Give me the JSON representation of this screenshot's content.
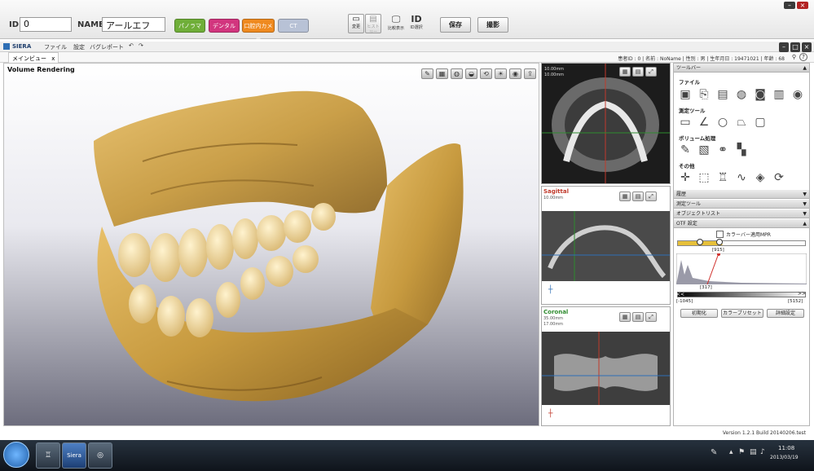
{
  "topbar": {
    "id_label": "ID",
    "id_value": "0",
    "name_label": "NAME",
    "name_value": "アールエフ",
    "mode_buttons": [
      {
        "label": "パノラマ",
        "color": "#6fae38"
      },
      {
        "label": "デンタル",
        "color": "#d2357e"
      },
      {
        "label": "口腔内カメラ",
        "color": "#ef8a1f"
      },
      {
        "label": "CT",
        "color": "#b8c2d6"
      }
    ],
    "icon_buttons": [
      {
        "label": "変更",
        "icon": "folder-icon"
      },
      {
        "label": "ヒストリー",
        "icon": "history-icon"
      },
      {
        "label": "比較表示",
        "icon": "monitor-icon"
      },
      {
        "label": "ID選択",
        "icon": "id-icon"
      }
    ],
    "id_icon_text": "ID",
    "save_label": "保存",
    "capture_label": "撮影"
  },
  "app": {
    "logo": "SIERA",
    "menu": [
      "ファイル",
      "設定",
      "バグレポート"
    ],
    "tab_label": "メインビュー",
    "tab_close": "x",
    "patient_info": "患者ID : 0 | 名前 : NoName | 性別 : 男 | 生年月日 : 19471021 | 年齢 : 68"
  },
  "mainview": {
    "title": "Volume Rendering"
  },
  "slices": {
    "axial": {
      "sub1": "10.00mm",
      "sub2": "10.00mm"
    },
    "sagittal": {
      "label": "Sagittal",
      "sub1": "10.00mm",
      "color": "#c0392b"
    },
    "coronal": {
      "label": "Coronal",
      "sub1": "35.00mm",
      "sub2": "17.00mm",
      "color": "#2e8b2e"
    }
  },
  "toolbar": {
    "title": "ツールバー",
    "groups": [
      {
        "title": "ファイル",
        "icons": [
          "open-icon",
          "export-icon",
          "save-icon",
          "print-icon",
          "camera-icon",
          "scan-icon",
          "cd-icon"
        ]
      },
      {
        "title": "測定ツール",
        "icons": [
          "ruler-icon",
          "angle-icon",
          "circle-icon",
          "polygon-icon",
          "note-icon"
        ]
      },
      {
        "title": "ボリューム処理",
        "icons": [
          "brush-icon",
          "crop-icon",
          "segment-icon",
          "map-icon"
        ]
      },
      {
        "title": "その他",
        "icons": [
          "crosshair-icon",
          "box-icon",
          "tooth-icon",
          "curve-icon",
          "cube-icon",
          "rotate-icon"
        ]
      }
    ],
    "sections": [
      "履歴",
      "測定ツール",
      "オブジェクトリスト",
      "OTF 設定"
    ],
    "otf": {
      "colorbar_label": "カラーバー適用MPR",
      "value_top": "[915]",
      "value_bottom": "[317]",
      "range_min": "[-1045]",
      "range_max": "[5152]",
      "left_arrow": "<<",
      "right_arrow": ">>",
      "buttons": [
        "初期化",
        "カラープリセット",
        "詳細設定"
      ]
    }
  },
  "status": {
    "version": "Version 1.2.1  Build 20140206.test"
  },
  "taskbar": {
    "apps": [
      {
        "label": "",
        "icon": "start-icon"
      },
      {
        "label": "",
        "icon": "tooth-app-icon"
      },
      {
        "label": "Siera",
        "icon": "siera-app-icon"
      },
      {
        "label": "",
        "icon": "viewer-app-icon"
      }
    ],
    "time": "11:08",
    "date": "2013/03/19"
  },
  "colors": {
    "accent_red": "#c0392b",
    "accent_green": "#2e8b2e",
    "bone": "#caa04c"
  }
}
